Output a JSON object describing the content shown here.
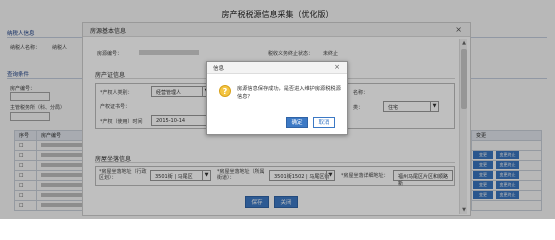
{
  "page": {
    "title": "房产税税源信息采集（优化版）",
    "taxpayer_section": "纳税人信息",
    "taxpayer_name_label": "纳税人名称：",
    "taxpayer_col2_label": "纳税人",
    "query_section": "查询条件",
    "property_no_label": "房产编号：",
    "query_button": "查询",
    "filter_label_1": "主管税务所（科、分局）",
    "table_headers": [
      "序号",
      "房产编号"
    ],
    "table_right_header": "变更",
    "row_btn_labels": [
      "变更",
      "变更终止"
    ]
  },
  "modal": {
    "title": "房源基本信息",
    "close": "×",
    "house_no_label": "房源编号：",
    "status_label": "税收义务终止状态：",
    "status_value": "未终止",
    "cert_section": "房产证信息",
    "owner_label": "*产权人类别：",
    "owner_value": "经营管理人",
    "cert_no_label": "产权证书号：",
    "date_label": "*产权（使用）时间",
    "date_value": "2015-10-14",
    "name_label": "名称：",
    "type_label": "类：",
    "type_value": "住宅",
    "addr_section": "房屋坐落信息",
    "addr1_label": "*房屋坐落地址（行政区划）：",
    "addr1_value": "3501街 | 马尾区",
    "addr2_label": "*房屋坐落地址（所属街道）：",
    "addr2_value": "3501街1502 | 马尾区街",
    "addr3_label": "*房屋坐落详细地址：",
    "addr3_value": "福州马尾区片区和顺路新",
    "save_button": "保存",
    "close_button": "关闭",
    "scroll_up": "▲",
    "scroll_down": "▼"
  },
  "dialog": {
    "title": "信息",
    "close": "×",
    "icon": "?",
    "message": "房源信息保存成功，是否进入维护房源税税源信息？",
    "ok": "确定",
    "cancel": "取消"
  }
}
